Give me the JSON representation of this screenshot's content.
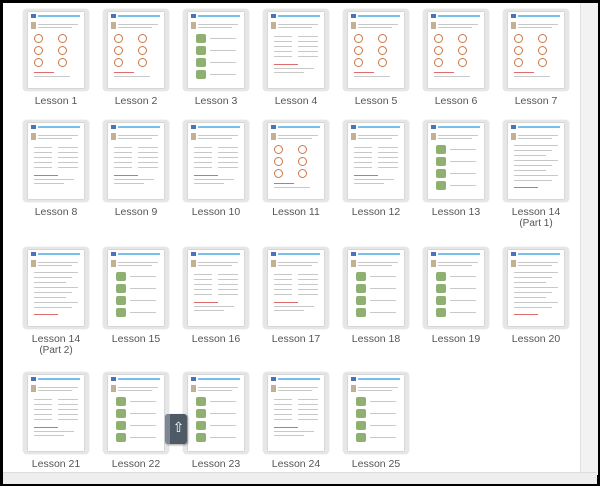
{
  "lessons": [
    {
      "label": "Lesson 1"
    },
    {
      "label": "Lesson 2"
    },
    {
      "label": "Lesson 3"
    },
    {
      "label": "Lesson 4"
    },
    {
      "label": "Lesson 5"
    },
    {
      "label": "Lesson 6"
    },
    {
      "label": "Lesson 7"
    },
    {
      "label": "Lesson 8"
    },
    {
      "label": "Lesson 9"
    },
    {
      "label": "Lesson 10"
    },
    {
      "label": "Lesson 11"
    },
    {
      "label": "Lesson 12"
    },
    {
      "label": "Lesson 13"
    },
    {
      "label": "Lesson 14",
      "sublabel": "(Part 1)"
    },
    {
      "label": "Lesson 14",
      "sublabel": "(Part 2)"
    },
    {
      "label": "Lesson 15"
    },
    {
      "label": "Lesson 16"
    },
    {
      "label": "Lesson 17"
    },
    {
      "label": "Lesson 18"
    },
    {
      "label": "Lesson 19"
    },
    {
      "label": "Lesson 20"
    },
    {
      "label": "Lesson 21"
    },
    {
      "label": "Lesson 22"
    },
    {
      "label": "Lesson 23"
    },
    {
      "label": "Lesson 24"
    },
    {
      "label": "Lesson 25"
    }
  ],
  "scroll_button": {
    "icon": "arrow-up-icon",
    "glyph": "⇧"
  },
  "colors": {
    "label": "#555555",
    "thumb_bg": "#e6e6e6",
    "header_blue": "#76c0ea",
    "accent_brown": "#c8794b"
  }
}
